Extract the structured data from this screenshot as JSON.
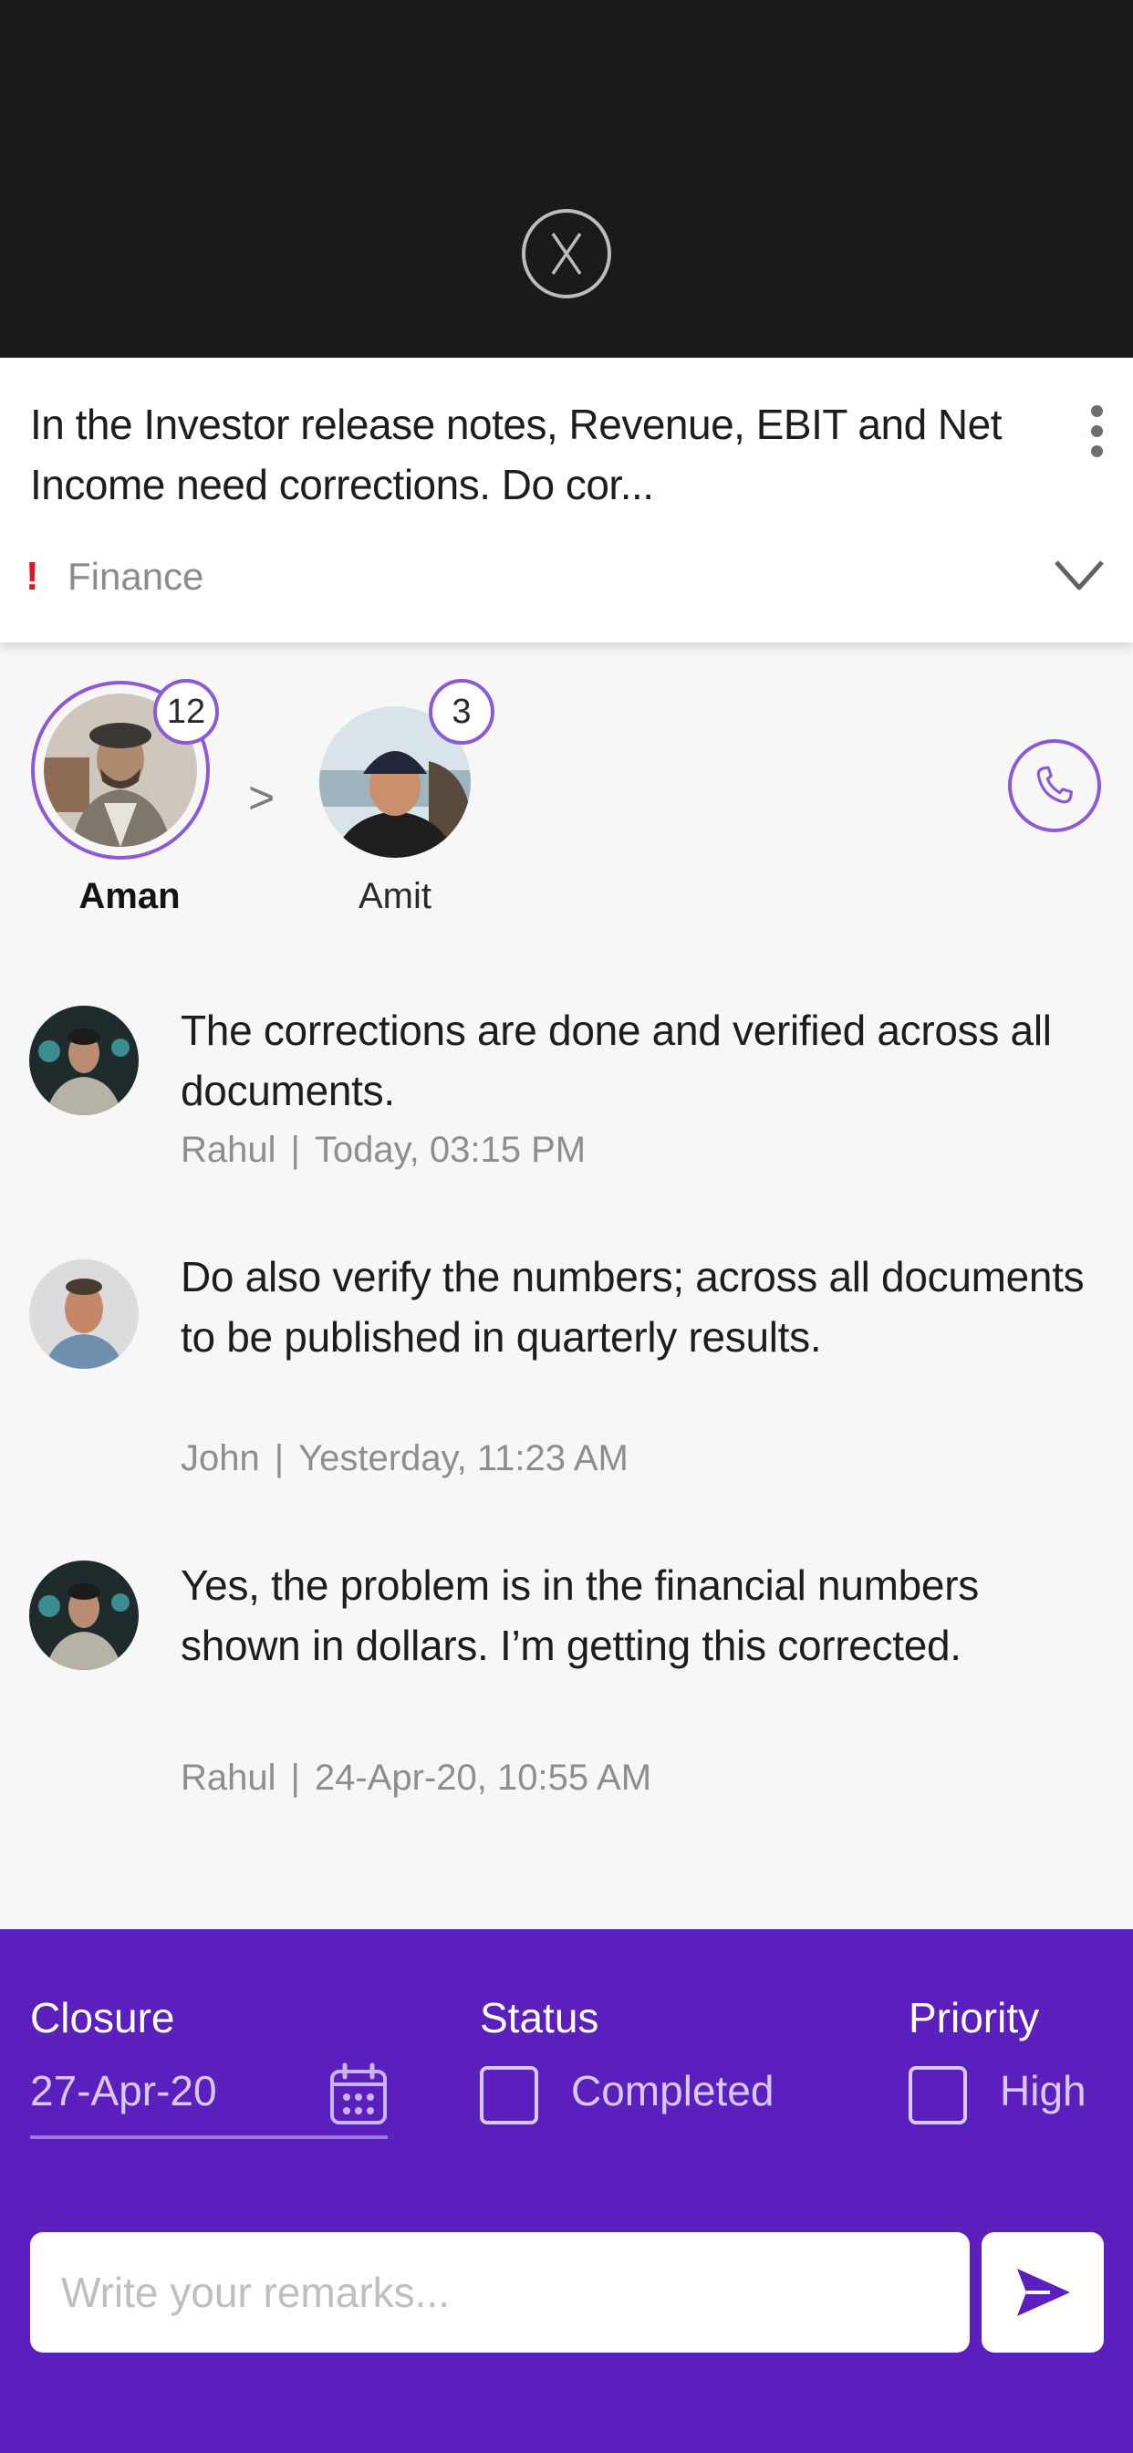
{
  "overlay": {
    "close_icon": "circle-x-icon"
  },
  "task": {
    "text": "In the Investor release notes, Revenue, EBIT and Net Income need corrections. Do cor...",
    "alert_mark": "!",
    "category": "Finance",
    "menu_icon": "kebab-icon",
    "expand_icon": "chevron-down-icon"
  },
  "assignees": [
    {
      "name": "Aman",
      "count": "12",
      "active": true
    },
    {
      "name": "Amit",
      "count": "3",
      "active": false
    }
  ],
  "assignee_arrow": ">",
  "call_icon": "phone-icon",
  "messages": [
    {
      "text": "The corrections are done and verified across all documents.",
      "author": "Rahul",
      "separator": "|",
      "time": "Today, 03:15 PM"
    },
    {
      "text": "Do also verify the numbers; across all documents to be published in quarterly results.",
      "author": "John",
      "separator": "|",
      "time": "Yesterday, 11:23 AM"
    },
    {
      "text": "Yes, the problem is in the financial numbers shown in dollars. I’m getting this corrected.",
      "author": "Rahul",
      "separator": "|",
      "time": "24-Apr-20, 10:55 AM"
    }
  ],
  "footer": {
    "closure_label": "Closure",
    "closure_value": "27-Apr-20",
    "status_label": "Status",
    "status_option": "Completed",
    "status_checked": false,
    "priority_label": "Priority",
    "priority_option": "High",
    "priority_checked": false,
    "remarks_placeholder": "Write your remarks...",
    "remarks_value": "",
    "send_icon": "send-icon"
  },
  "colors": {
    "accent": "#5b1fbd",
    "ring": "#8a5ad8",
    "alert": "#e0141e",
    "overlay": "#1a1a1a"
  }
}
